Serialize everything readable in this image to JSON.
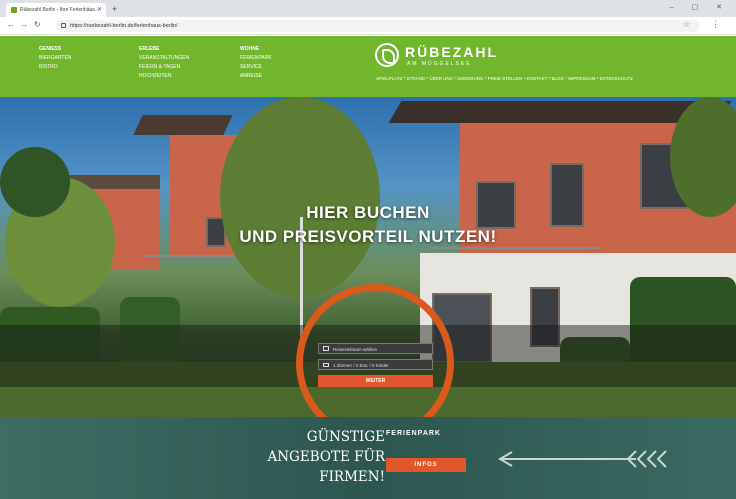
{
  "browser": {
    "tab_title": "Rübezahl Berlin - Ihre Ferienhäus...",
    "url": "https://ruebezahl-berlin.de/ferienhaus-berlin/"
  },
  "header": {
    "logo_name": "RÜBEZAHL",
    "logo_sub": "AM MÜGGELSEE",
    "nav_columns": [
      {
        "heading": "GENIESS",
        "items": [
          "BIERGARTEN",
          "BISTRO"
        ]
      },
      {
        "heading": "ERLEBE",
        "items": [
          "VERANSTALTUNGEN",
          "FEIERN & TAGEN",
          "HOCHZEITEN"
        ]
      },
      {
        "heading": "WOHNE",
        "items": [
          "FERIENPARK",
          "SERVICE",
          "ANREISE"
        ]
      }
    ],
    "top_menu": "SPIELPLATZ * STRAND * ÜBER UNS * UMGEBUNG * FREIE STELLEN * KONTAKT * BLOG * IMPRESSUM * DATENSCHUTZ"
  },
  "hero": {
    "headline_line1": "HIER BUCHEN",
    "headline_line2": "UND PREISVORTEIL NUTZEN!"
  },
  "booking": {
    "date_field": "Reisezeitraum wählen",
    "guests_field": "1 Zimmer / 2 Erw. / 0 Kinder",
    "submit_label": "WEITER"
  },
  "banner": {
    "promo_line1": "GÜNSTIGE",
    "promo_line2": "ANGEBOTE FÜR",
    "promo_line3": "FIRMEN!",
    "ferien_label": "FERIENPARK",
    "infos_label": "INFOS"
  },
  "colors": {
    "brand_green": "#72b62d",
    "accent_orange": "#e2562a",
    "highlight_ring": "#d95a1a",
    "banner_teal": "#2d5650"
  },
  "icons": [
    "back-icon",
    "forward-icon",
    "reload-icon",
    "lock-icon",
    "star-icon",
    "menu-icon",
    "calendar-icon",
    "bed-icon",
    "arrow-icon"
  ]
}
